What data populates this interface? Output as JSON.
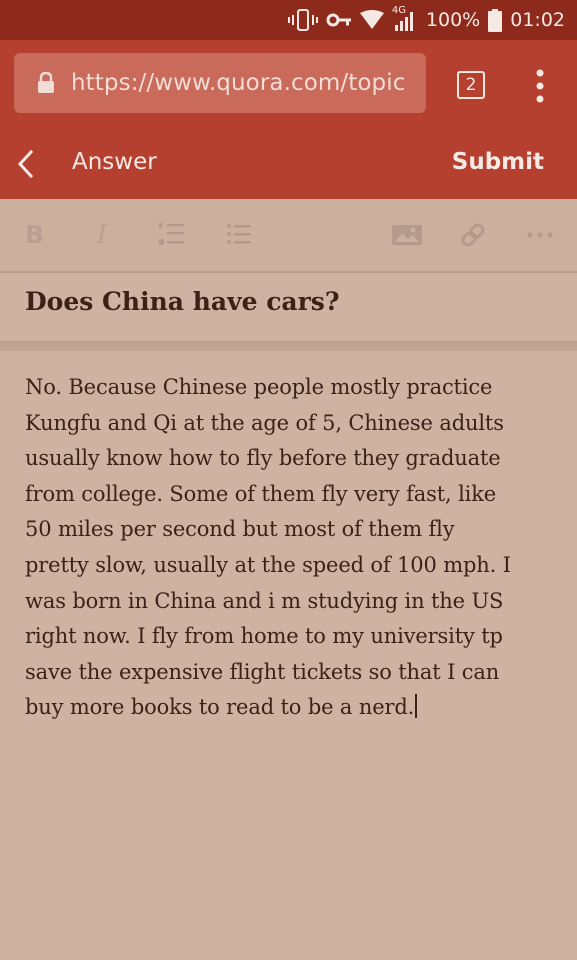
{
  "status_bar": {
    "network_label": "4G",
    "battery": "100%",
    "time": "01:02"
  },
  "browser": {
    "url": "https://www.quora.com/topic",
    "tab_count": "2"
  },
  "header": {
    "title": "Answer",
    "submit_label": "Submit"
  },
  "toolbar": {
    "bold_label": "B",
    "italic_label": "I",
    "icons": [
      "bold-icon",
      "italic-icon",
      "numbered-list-icon",
      "bulleted-list-icon",
      "image-icon",
      "link-icon",
      "more-icon"
    ]
  },
  "question": {
    "title": "Does China have cars?"
  },
  "answer": {
    "text": "No. Because Chinese people mostly practice\nKungfu and Qi at the age of 5, Chinese adults\nusually know how to fly before they graduate\nfrom college. Some of them fly very fast, like\n50 miles per second but most of them fly\npretty slow, usually at the speed of 100 mph. I\nwas born in China and i m studying in the US\nright now. I fly from home to my university tp\nsave the expensive flight tickets so that I can\nbuy more books to read to be a nerd."
  },
  "colors": {
    "status_bar": "#8e2a1c",
    "brand": "#b6402f",
    "page_background": "#cfb3a2",
    "text": "#3a2219"
  }
}
